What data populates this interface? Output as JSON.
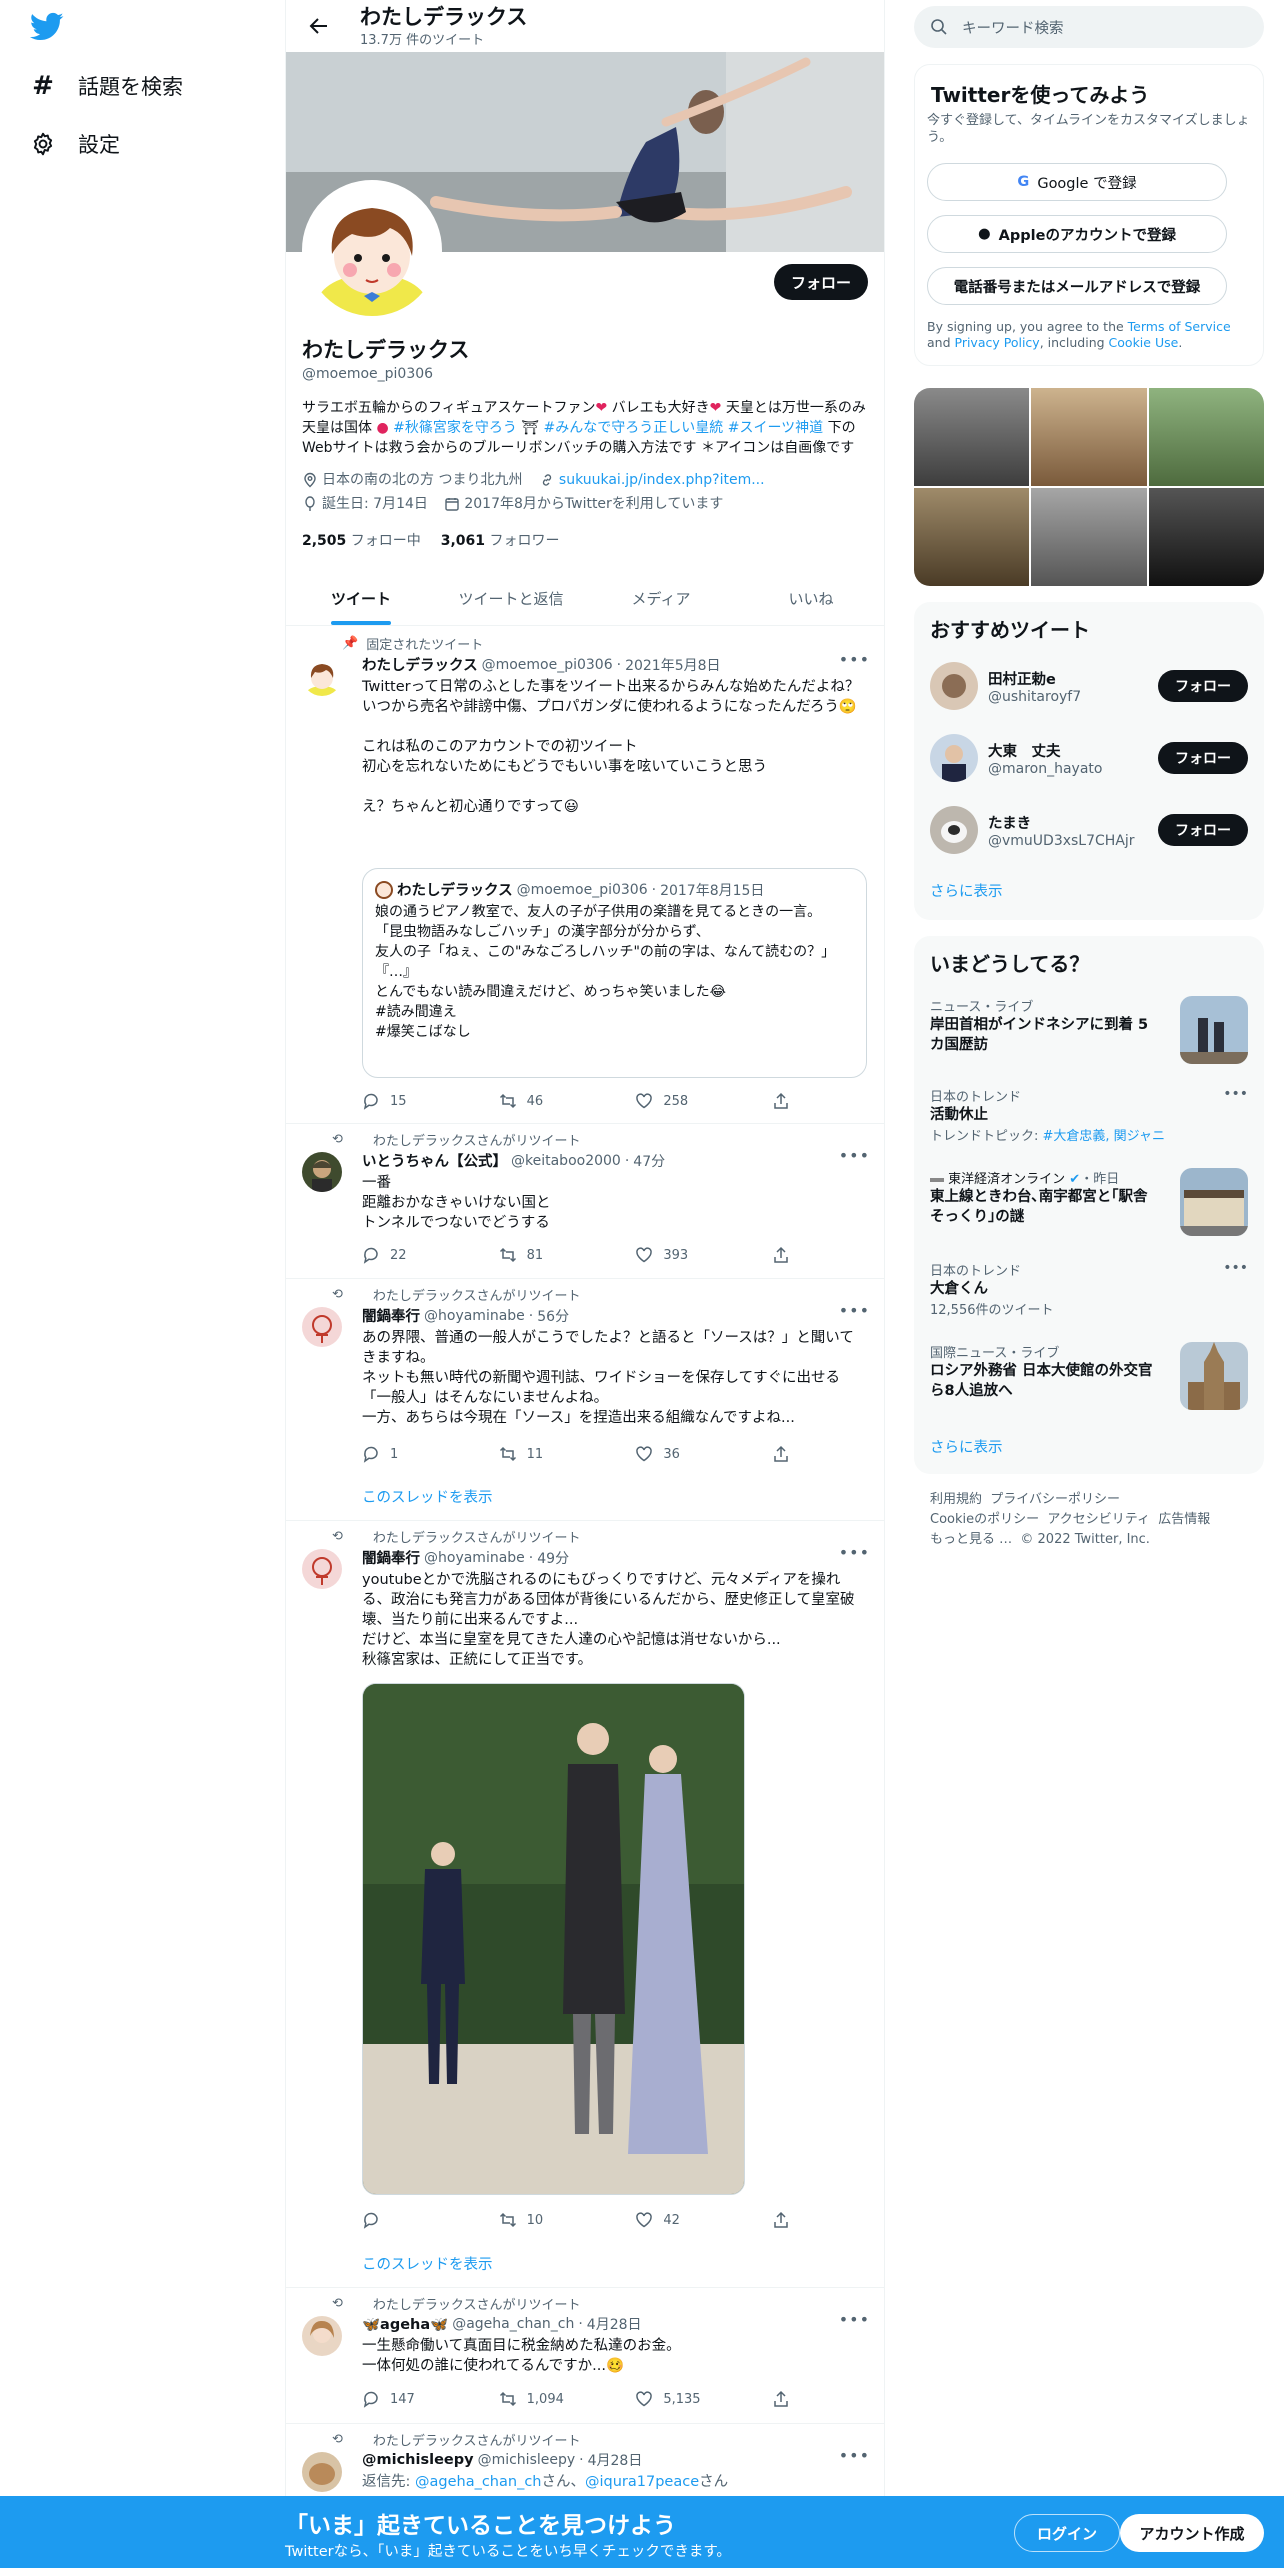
{
  "colors": {
    "accent": "#1d9bf0",
    "text": "#0f1419",
    "muted": "#536471",
    "bar": "#1d9bf0"
  },
  "nav": {
    "explore": "話題を検索",
    "settings": "設定"
  },
  "header": {
    "name": "わたしデラックス",
    "tweet_count": "13.7万 件のツイート"
  },
  "profile": {
    "follow_label": "フォロー",
    "name": "わたしデラックス",
    "handle": "@moemoe_pi0306",
    "bio_1": "サラエボ五輪からのフィギュアスケートファン",
    "bio_2": " バレエも大好き",
    "bio_3": " 天皇とは万世一系のみ 天皇は国体",
    "bio_tag1": "#秋篠宮家を守ろう",
    "bio_tag2": "#みんなで守ろう正しい皇統",
    "bio_tag3": "#スイーツ神道",
    "bio_4": " 下のWebサイトは救う会からのブルーリボンバッチの購入方法です ＊アイコンは自画像です",
    "location": "日本の南の北の方 つまり北九州",
    "website": "sukuukai.jp/index.php?item...",
    "birthday": "誕生日: 7月14日",
    "joined": "2017年8月からTwitterを利用しています",
    "following_count": "2,505",
    "following_label": "フォロー中",
    "followers_count": "3,061",
    "followers_label": "フォロワー"
  },
  "tabs": [
    "ツイート",
    "ツイートと返信",
    "メディア",
    "いいね"
  ],
  "tweets": [
    {
      "pre": "固定されたツイート",
      "name": "わたしデラックス",
      "handle": "@moemoe_pi0306",
      "time": "2021年5月8日",
      "text": "Twitterって日常のふとした事をツイート出来るからみんな始めたんだよね？\nいつから売名や誹謗中傷、プロパガンダに使われるようになったんだろう🙄\n\nこれは私のこのアカウントでの初ツイート\n初心を忘れないためにもどうでもいい事を呟いていこうと思う\n\nえ？ちゃんと初心通りですって😃",
      "quote": {
        "name": "わたしデラックス",
        "handle": "@moemoe_pi0306",
        "time": "2017年8月15日",
        "text": "娘の通うピアノ教室で、友人の子が子供用の楽譜を見てるときの一言。\n「昆虫物語みなしごハッチ」の漢字部分が分からず、\n友人の子「ねぇ、この\"みなごろしハッチ\"の前の字は、なんて読むの？」\n『…』\nとんでもない読み間違えだけど、めっちゃ笑いました😂\n#読み間違え\n#爆笑こばなし"
      },
      "replies": "15",
      "retweets": "46",
      "likes": "258"
    },
    {
      "pre": "わたしデラックスさんがリツイート",
      "name": "いとうちゃん【公式】",
      "handle": "@keitaboo2000",
      "time": "47分",
      "text": "一番\n距離おかなきゃいけない国と\nトンネルでつないでどうする",
      "replies": "22",
      "retweets": "81",
      "likes": "393"
    },
    {
      "pre": "わたしデラックスさんがリツイート",
      "name": "闇鍋奉行",
      "handle": "@hoyaminabe",
      "time": "56分",
      "text": "あの界隈、普通の一般人がこうでしたよ？と語ると「ソースは？」と聞いてきますね。\nネットも無い時代の新聞や週刊誌、ワイドショーを保存してすぐに出せる「一般人」はそんなにいませんよね。\n一方、あちらは今現在「ソース」を捏造出来る組織なんですよね...",
      "replies": "1",
      "retweets": "11",
      "likes": "36",
      "thread": "このスレッドを表示"
    },
    {
      "pre": "わたしデラックスさんがリツイート",
      "name": "闇鍋奉行",
      "handle": "@hoyaminabe",
      "time": "49分",
      "text": "youtubeとかで洗脳されるのにもびっくりですけど、元々メディアを操れる、政治にも発言力がある団体が背後にいるんだから、歴史修正して皇室破壊、当たり前に出来るんですよ...\nだけど、本当に皇室を見てきた人達の心や記憶は消せないから...\n秋篠宮家は、正統にして正当です。",
      "replies": "",
      "retweets": "10",
      "likes": "42",
      "thread": "このスレッドを表示"
    },
    {
      "pre": "わたしデラックスさんがリツイート",
      "name": "🦋ageha🦋",
      "handle": "@ageha_chan_ch",
      "time": "4月28日",
      "text": "一生懸命働いて真面目に税金納めた私達のお金。\n一体何処の誰に使われてるんですか...🥴",
      "replies": "147",
      "retweets": "1,094",
      "likes": "5,135"
    },
    {
      "pre": "わたしデラックスさんがリツイート",
      "name": "@michisleepy",
      "handle": "@michisleepy",
      "time": "4月28日",
      "reply_to_label": "返信先: ",
      "reply_to_1": "@ageha_chan_ch",
      "reply_to_mid": "さん、",
      "reply_to_2": "@iqura17peace",
      "reply_to_end": "さん"
    }
  ],
  "search": {
    "placeholder": "キーワード検索"
  },
  "signup": {
    "title": "Twitterを使ってみよう",
    "subtitle": "今すぐ登録して、タイムラインをカスタマイズしましょう。",
    "google": "Google で登録",
    "apple": "Appleのアカウントで登録",
    "phone": "電話番号またはメールアドレスで登録",
    "terms_1": "By signing up, you agree to the ",
    "terms_link1": "Terms of Service",
    "terms_2": " and ",
    "terms_link2": "Privacy Policy",
    "terms_3": ", including ",
    "terms_link3": "Cookie Use",
    "terms_4": "."
  },
  "recommend": {
    "title": "おすすめツイート",
    "users": [
      {
        "name": "田村正勅e",
        "handle": "@ushitaroyf7",
        "button": "フォロー"
      },
      {
        "name": "大東　丈夫",
        "handle": "@maron_hayato",
        "button": "フォロー"
      },
      {
        "name": "たまき",
        "handle": "@vmuUD3xsL7CHAjr",
        "button": "フォロー"
      }
    ],
    "more": "さらに表示"
  },
  "trends": {
    "title": "いまどうしてる？",
    "items": [
      {
        "category": "ニュース・ライブ",
        "title": "岸田首相がインドネシアに到着 5カ国歴訪"
      },
      {
        "category": "日本のトレンド",
        "title": "活動休止",
        "sub_label": "トレンドトピック: ",
        "sub_link": "#大倉忠義, 関ジャニ"
      },
      {
        "category": "東洋経済オンライン",
        "time": "・昨日",
        "title": "東上線ときわ台､南宇都宮と｢駅舎そっくり｣の謎"
      },
      {
        "category": "日本のトレンド",
        "title": "大倉くん",
        "sub": "12,556件のツイート"
      },
      {
        "category": "国際ニュース・ライブ",
        "title": "ロシア外務省 日本大使館の外交官ら8人追放へ"
      }
    ],
    "more": "さらに表示"
  },
  "footer": {
    "links": [
      "利用規約",
      "プライバシーポリシー",
      "Cookieのポリシー",
      "アクセシビリティ",
      "広告情報",
      "もっと見る …"
    ],
    "copyright": "© 2022 Twitter, Inc."
  },
  "bottombar": {
    "title": "「いま」起きていることを見つけよう",
    "subtitle": "Twitterなら、「いま」起きていることをいち早くチェックできます。",
    "login": "ログイン",
    "signup": "アカウント作成"
  }
}
